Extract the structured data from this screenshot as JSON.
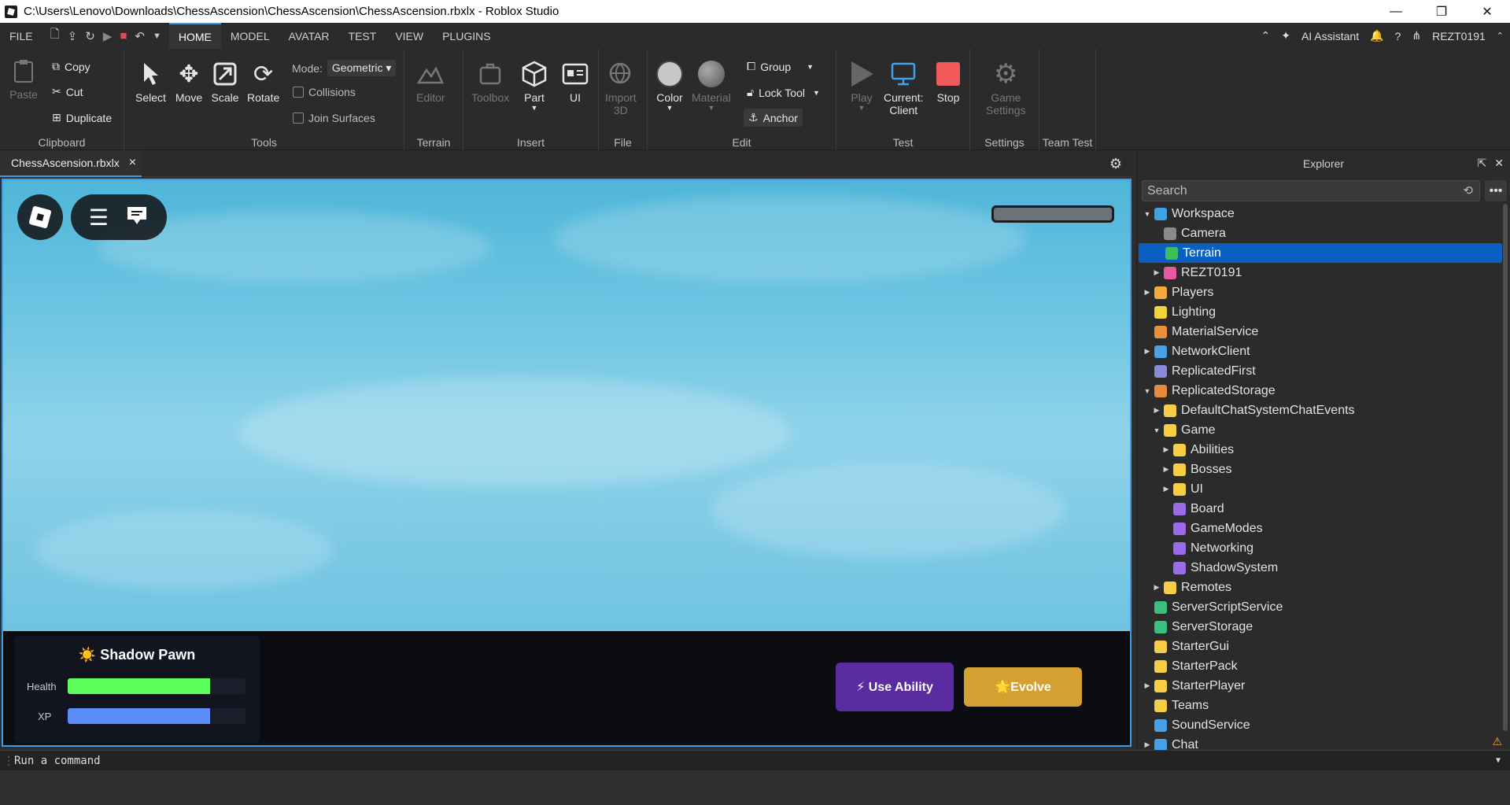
{
  "window": {
    "title": "C:\\Users\\Lenovo\\Downloads\\ChessAscension\\ChessAscension\\ChessAscension.rbxlx - Roblox Studio"
  },
  "menubar": {
    "file": "FILE",
    "tabs": [
      "HOME",
      "MODEL",
      "AVATAR",
      "TEST",
      "VIEW",
      "PLUGINS"
    ],
    "active_tab": "HOME",
    "ai_assistant": "AI Assistant",
    "username": "REZT0191"
  },
  "ribbon": {
    "clipboard": {
      "paste": "Paste",
      "copy": "Copy",
      "cut": "Cut",
      "duplicate": "Duplicate",
      "group": "Clipboard"
    },
    "tools": {
      "select": "Select",
      "move": "Move",
      "scale": "Scale",
      "rotate": "Rotate",
      "mode_label": "Mode:",
      "mode_value": "Geometric",
      "collisions": "Collisions",
      "join_surfaces": "Join Surfaces",
      "group": "Tools"
    },
    "terrain": {
      "editor": "Editor",
      "group": "Terrain"
    },
    "insert": {
      "toolbox": "Toolbox",
      "part": "Part",
      "ui": "UI",
      "group": "Insert"
    },
    "file": {
      "import_line1": "Import",
      "import_line2": "3D",
      "group": "File"
    },
    "edit": {
      "color": "Color",
      "material": "Material",
      "group_btn": "Group",
      "lock_tool": "Lock Tool",
      "anchor": "Anchor",
      "group": "Edit"
    },
    "test": {
      "play": "Play",
      "current_line1": "Current:",
      "current_line2": "Client",
      "stop": "Stop",
      "group": "Test"
    },
    "settings": {
      "game_line1": "Game",
      "game_line2": "Settings",
      "group": "Settings"
    },
    "team_test": {
      "group": "Team Test"
    }
  },
  "doc_tab": {
    "label": "ChessAscension.rbxlx"
  },
  "hud": {
    "piece_name": "☀️ Shadow Pawn",
    "health_label": "Health",
    "health_fraction": 0.8,
    "xp_label": "XP",
    "xp_fraction": 0.8,
    "use_ability": "⚡ Use Ability",
    "evolve": "🌟Evolve",
    "colors": {
      "health": "#5dff5d",
      "xp": "#5b8cf7",
      "ability_btn": "#5a2ca0",
      "evolve_btn": "#d4a032"
    }
  },
  "explorer": {
    "title": "Explorer",
    "search_placeholder": "Search",
    "tree": [
      {
        "label": "Workspace",
        "arrow": "▼",
        "indent": 0,
        "icon": "#3ea1e8"
      },
      {
        "label": "Camera",
        "arrow": "",
        "indent": 1,
        "icon": "#8a8a8a"
      },
      {
        "label": "Terrain",
        "arrow": "",
        "indent": 1,
        "icon": "#3bbf5c",
        "selected": true
      },
      {
        "label": "REZT0191",
        "arrow": "▶",
        "indent": 1,
        "icon": "#e85aa0"
      },
      {
        "label": "Players",
        "arrow": "▶",
        "indent": 0,
        "icon": "#f4a73a"
      },
      {
        "label": "Lighting",
        "arrow": "",
        "indent": 0,
        "icon": "#f6d23a"
      },
      {
        "label": "MaterialService",
        "arrow": "",
        "indent": 0,
        "icon": "#e8913a"
      },
      {
        "label": "NetworkClient",
        "arrow": "▶",
        "indent": 0,
        "icon": "#4aa0e8"
      },
      {
        "label": "ReplicatedFirst",
        "arrow": "",
        "indent": 0,
        "icon": "#8a8ad8"
      },
      {
        "label": "ReplicatedStorage",
        "arrow": "▼",
        "indent": 0,
        "icon": "#e88a3a"
      },
      {
        "label": "DefaultChatSystemChatEvents",
        "arrow": "▶",
        "indent": 1,
        "icon": "#f6cd45"
      },
      {
        "label": "Game",
        "arrow": "▼",
        "indent": 1,
        "icon": "#f6cd45"
      },
      {
        "label": "Abilities",
        "arrow": "▶",
        "indent": 2,
        "icon": "#f6cd45"
      },
      {
        "label": "Bosses",
        "arrow": "▶",
        "indent": 2,
        "icon": "#f6cd45"
      },
      {
        "label": "UI",
        "arrow": "▶",
        "indent": 2,
        "icon": "#f6cd45"
      },
      {
        "label": "Board",
        "arrow": "",
        "indent": 2,
        "icon": "#9b6ce8"
      },
      {
        "label": "GameModes",
        "arrow": "",
        "indent": 2,
        "icon": "#9b6ce8"
      },
      {
        "label": "Networking",
        "arrow": "",
        "indent": 2,
        "icon": "#9b6ce8"
      },
      {
        "label": "ShadowSystem",
        "arrow": "",
        "indent": 2,
        "icon": "#9b6ce8"
      },
      {
        "label": "Remotes",
        "arrow": "▶",
        "indent": 1,
        "icon": "#f6cd45"
      },
      {
        "label": "ServerScriptService",
        "arrow": "",
        "indent": 0,
        "icon": "#3bbf7c"
      },
      {
        "label": "ServerStorage",
        "arrow": "",
        "indent": 0,
        "icon": "#3bbf7c"
      },
      {
        "label": "StarterGui",
        "arrow": "",
        "indent": 0,
        "icon": "#f6cd45"
      },
      {
        "label": "StarterPack",
        "arrow": "",
        "indent": 0,
        "icon": "#f6cd45"
      },
      {
        "label": "StarterPlayer",
        "arrow": "▶",
        "indent": 0,
        "icon": "#f6cd45"
      },
      {
        "label": "Teams",
        "arrow": "",
        "indent": 0,
        "icon": "#f6cd45"
      },
      {
        "label": "SoundService",
        "arrow": "",
        "indent": 0,
        "icon": "#4aa0e8"
      },
      {
        "label": "Chat",
        "arrow": "▶",
        "indent": 0,
        "icon": "#4aa0e8"
      }
    ]
  },
  "command_bar": {
    "placeholder": "Run a command"
  }
}
